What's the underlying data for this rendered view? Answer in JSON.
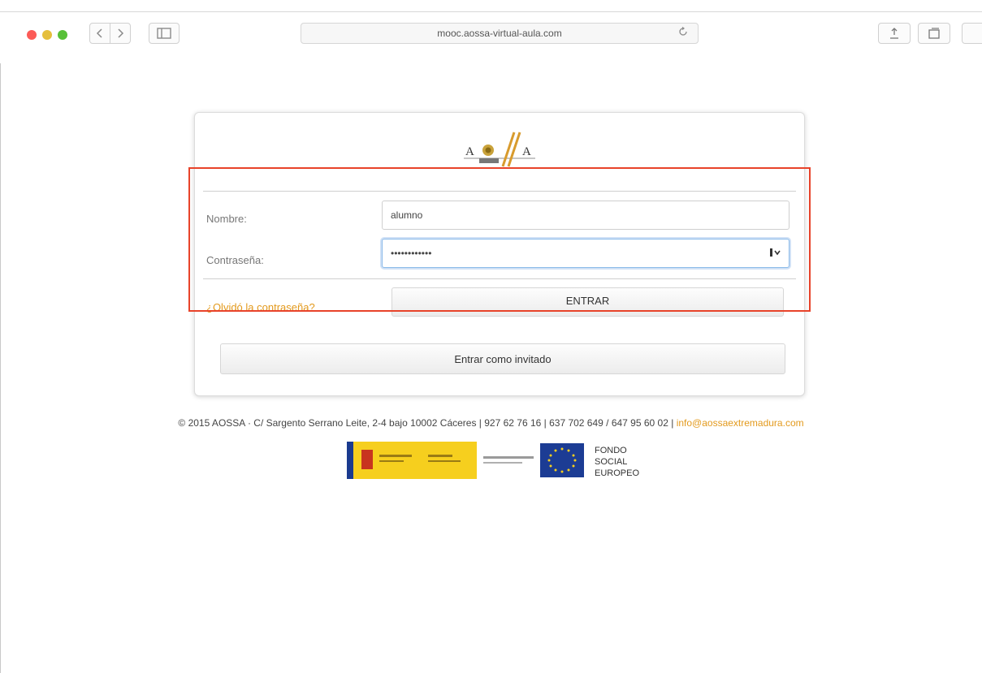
{
  "browser": {
    "address": "mooc.aossa-virtual-aula.com"
  },
  "login": {
    "username_label": "Nombre:",
    "username_value": "alumno",
    "password_label": "Contraseña:",
    "password_value": "••••••••••••",
    "forgot_link": "¿Olvidó la contraseña?",
    "enter_button": "ENTRAR",
    "guest_button": "Entrar como invitado"
  },
  "footer": {
    "text": "© 2015 AOSSA · C/ Sargento Serrano Leite, 2-4 bajo 10002 Cáceres | 927 62 76 16 | 637 702 649 / 647 95 60 02 | ",
    "email": "info@aossaextremadura.com",
    "eu_fund_text": "FONDO SOCIAL EUROPEO"
  },
  "colors": {
    "accent_link": "#e39a1d",
    "highlight": "#e8432a"
  }
}
